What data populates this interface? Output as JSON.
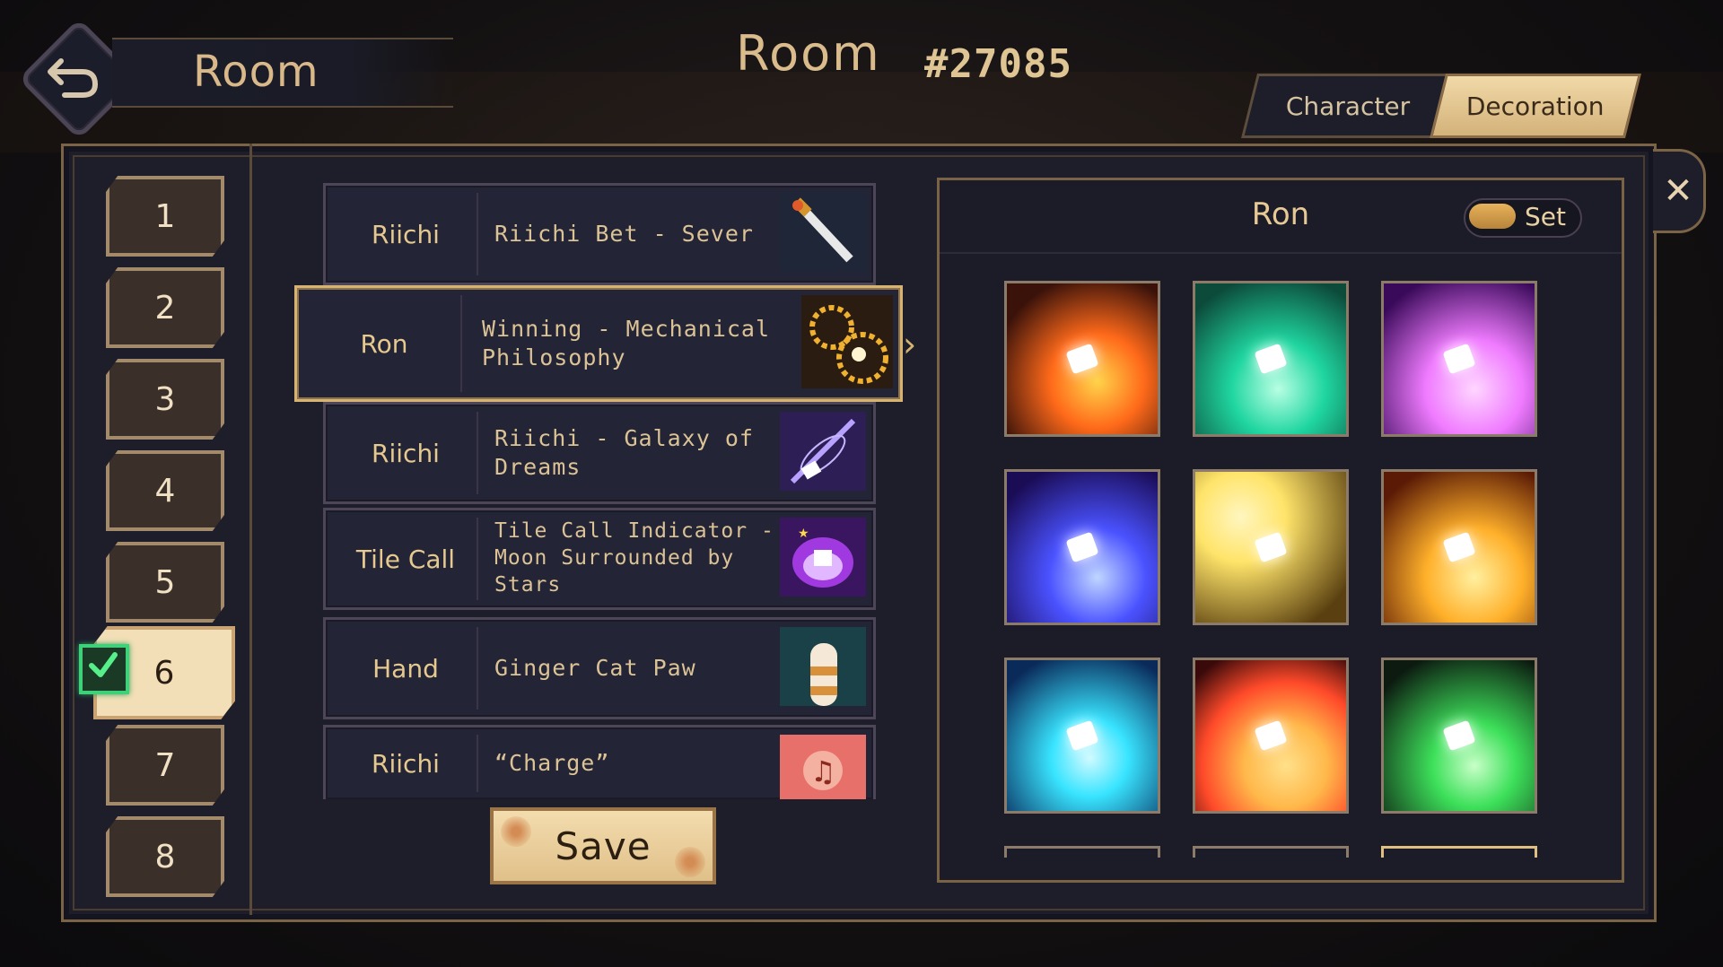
{
  "header": {
    "back_title": "Room",
    "room_label": "Room",
    "room_id": "#27085"
  },
  "tabs": [
    {
      "label": "Character",
      "active": false
    },
    {
      "label": "Decoration",
      "active": true
    }
  ],
  "slots": [
    "1",
    "2",
    "3",
    "4",
    "5",
    "6",
    "7",
    "8"
  ],
  "selected_slot": "6",
  "decorations": [
    {
      "category": "Riichi",
      "name": "Riichi Bet - Sever"
    },
    {
      "category": "Ron",
      "name": "Winning - Mechanical Philosophy"
    },
    {
      "category": "Riichi",
      "name": "Riichi - Galaxy of Dreams"
    },
    {
      "category": "Tile Call",
      "name": "Tile Call Indicator - Moon Surrounded by Stars"
    },
    {
      "category": "Hand",
      "name": "Ginger Cat Paw"
    },
    {
      "category": "Riichi",
      "name": "“Charge”"
    }
  ],
  "save_label": "Save",
  "panel": {
    "title": "Ron",
    "toggle_label": "Set"
  },
  "effect_tiles": [
    {
      "name": "fire-burst-icon",
      "colors": [
        "#ff6a1a",
        "#ffd44a"
      ]
    },
    {
      "name": "green-tornado-icon",
      "colors": [
        "#1fd6a0",
        "#0c4a3a"
      ]
    },
    {
      "name": "pink-beam-icon",
      "colors": [
        "#f07bff",
        "#5a1a7a"
      ]
    },
    {
      "name": "blue-purple-beam-icon",
      "colors": [
        "#4a52ff",
        "#1a0c55"
      ]
    },
    {
      "name": "golden-light-icon",
      "colors": [
        "#ffe46a",
        "#5a4010"
      ]
    },
    {
      "name": "flame-wings-icon",
      "colors": [
        "#ffb02a",
        "#5a1a05"
      ]
    },
    {
      "name": "cyan-ring-icon",
      "colors": [
        "#38e4ff",
        "#0a2a5a"
      ]
    },
    {
      "name": "ko-burst-icon",
      "colors": [
        "#ff4a2a",
        "#ffb84a"
      ]
    },
    {
      "name": "green-shadow-icon",
      "colors": [
        "#3de05a",
        "#0c1a10"
      ]
    }
  ]
}
